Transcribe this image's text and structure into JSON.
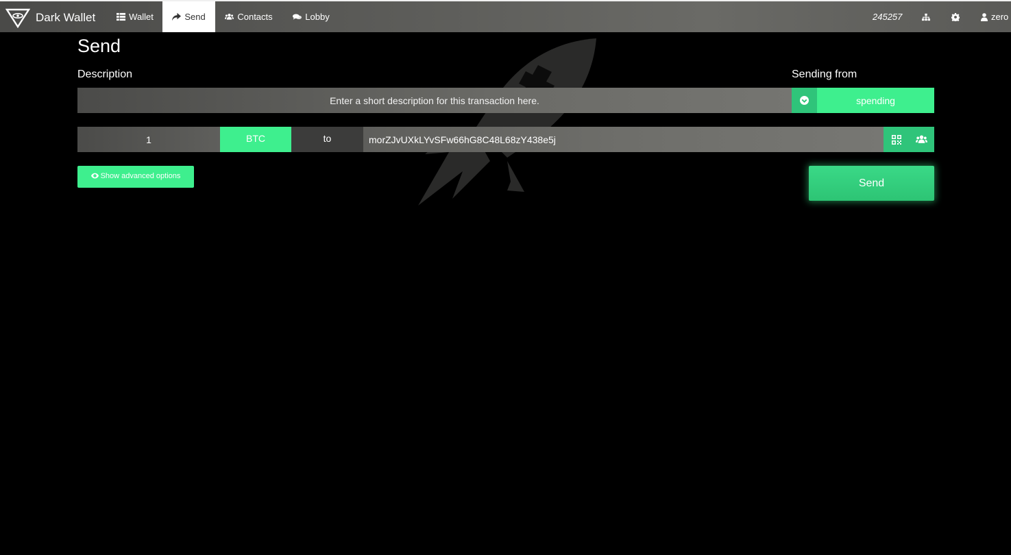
{
  "app": {
    "brand_name": "Dark Wallet"
  },
  "nav": {
    "tabs": [
      {
        "label": "Wallet",
        "icon": "th-icon"
      },
      {
        "label": "Send",
        "icon": "share-icon",
        "active": true
      },
      {
        "label": "Contacts",
        "icon": "users-icon"
      },
      {
        "label": "Lobby",
        "icon": "comments-icon"
      }
    ],
    "block_height": "245257",
    "user_label": "zero"
  },
  "send_form": {
    "title": "Send",
    "description_label": "Description",
    "description_placeholder": "Enter a short description for this transaction here.",
    "sending_from_label": "Sending from",
    "pocket": "spending",
    "amount": "1",
    "currency": "BTC",
    "to_label": "to",
    "address": "morZJvUXkLYvSFw66hG8C48L68zY438e5j",
    "advanced_label": "Show advanced options",
    "send_label": "Send"
  },
  "colors": {
    "accent": "#3eef8e",
    "accent_dark": "#2fc47a",
    "background": "#000000"
  }
}
